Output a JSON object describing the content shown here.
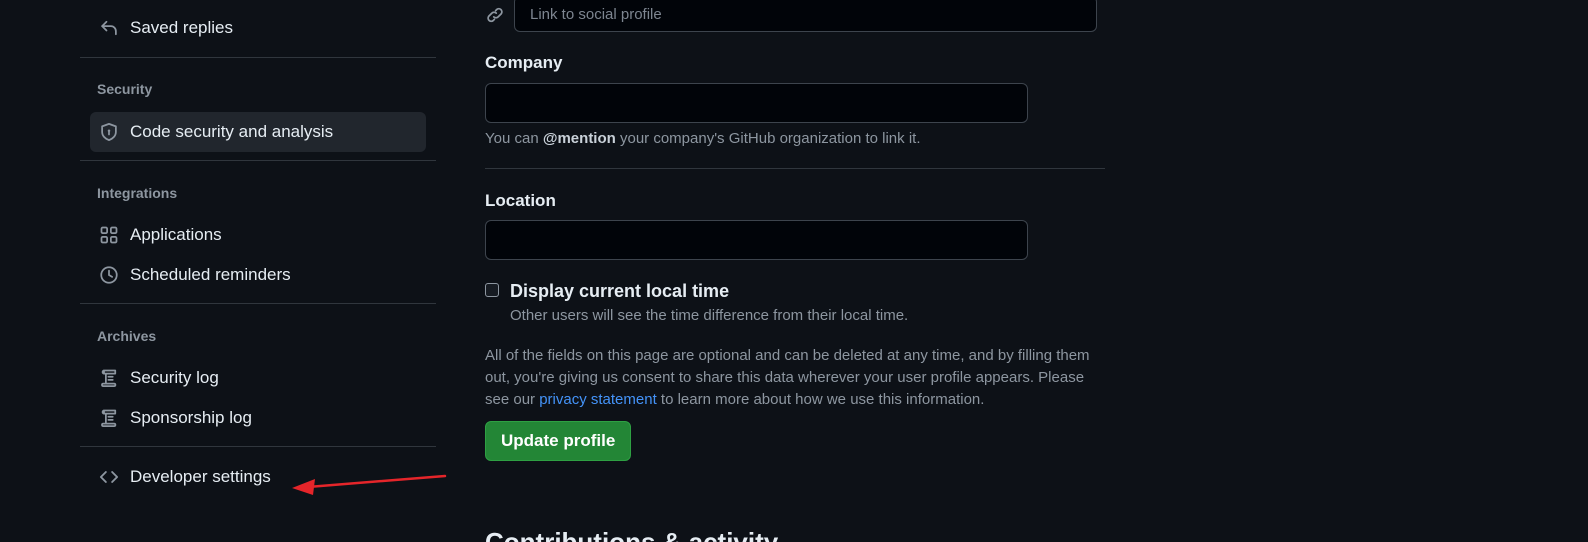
{
  "sidebar": {
    "saved_replies": "Saved replies",
    "security_title": "Security",
    "code_security": "Code security and analysis",
    "integrations_title": "Integrations",
    "applications": "Applications",
    "scheduled_reminders": "Scheduled reminders",
    "archives_title": "Archives",
    "security_log": "Security log",
    "sponsorship_log": "Sponsorship log",
    "developer_settings": "Developer settings"
  },
  "form": {
    "social_placeholder": "Link to social profile",
    "company_label": "Company",
    "company_value": "",
    "company_note_prefix": "You can ",
    "company_note_mention": "@mention",
    "company_note_suffix": " your company's GitHub organization to link it.",
    "location_label": "Location",
    "location_value": "",
    "local_time_label": "Display current local time",
    "local_time_note": "Other users will see the time difference from their local time.",
    "local_time_checked": false,
    "disclaimer_prefix": "All of the fields on this page are optional and can be deleted at any time, and by filling them out, you're giving us consent to share this data wherever your user profile appears. Please see our ",
    "privacy_link": "privacy statement",
    "disclaimer_suffix": " to learn more about how we use this information.",
    "update_button": "Update profile",
    "next_heading": "Contributions & activity"
  },
  "colors": {
    "background": "#0d1117",
    "active_item": "#21262d",
    "primary_button": "#238636",
    "link": "#4493f8",
    "annotation_arrow": "#e5252a"
  },
  "icons": {
    "saved_replies": "reply-icon",
    "code_security": "shield-icon",
    "applications": "apps-grid-icon",
    "scheduled_reminders": "clock-icon",
    "security_log": "log-icon",
    "sponsorship_log": "log-icon",
    "developer_settings": "code-icon",
    "social": "link-icon"
  }
}
